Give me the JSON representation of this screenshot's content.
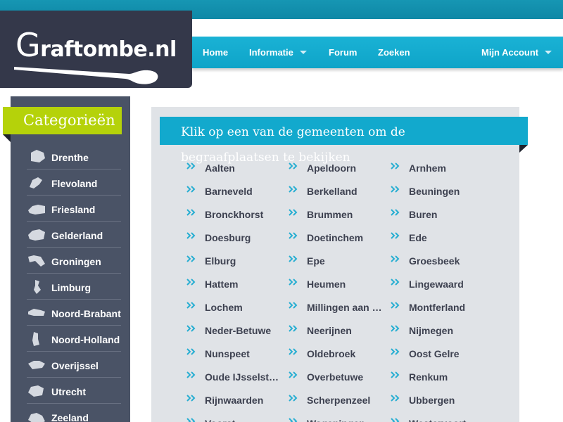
{
  "site": {
    "logo_text": "raftombe.nl",
    "logo_initial": "G"
  },
  "nav": {
    "items": [
      {
        "label": "Home"
      },
      {
        "label": "Informatie"
      },
      {
        "label": "Forum"
      },
      {
        "label": "Zoeken"
      },
      {
        "label": "Mijn Account"
      }
    ]
  },
  "sidebar": {
    "title": "Categorieën",
    "items": [
      {
        "label": "Drenthe"
      },
      {
        "label": "Flevoland"
      },
      {
        "label": "Friesland"
      },
      {
        "label": "Gelderland"
      },
      {
        "label": "Groningen"
      },
      {
        "label": "Limburg"
      },
      {
        "label": "Noord-Brabant"
      },
      {
        "label": "Noord-Holland"
      },
      {
        "label": "Overijssel"
      },
      {
        "label": "Utrecht"
      },
      {
        "label": "Zeeland"
      }
    ]
  },
  "main": {
    "heading": "Klik op een van de gemeenten om de begraafplaatsen te bekijken",
    "columns": [
      [
        "Aalten",
        "Barneveld",
        "Bronckhorst",
        "Doesburg",
        "Elburg",
        "Hattem",
        "Lochem",
        "Neder-Betuwe",
        "Nunspeet",
        "Oude IJsselstreek",
        "Rijnwaarden",
        "Voorst"
      ],
      [
        "Apeldoorn",
        "Berkelland",
        "Brummen",
        "Doetinchem",
        "Epe",
        "Heumen",
        "Millingen aan de Rijn",
        "Neerijnen",
        "Oldebroek",
        "Overbetuwe",
        "Scherpenzeel",
        "Wageningen"
      ],
      [
        "Arnhem",
        "Beuningen",
        "Buren",
        "Ede",
        "Groesbeek",
        "Lingewaard",
        "Montferland",
        "Nijmegen",
        "Oost Gelre",
        "Renkum",
        "Ubbergen",
        "Westervoort"
      ]
    ]
  },
  "colors": {
    "accent": "#12a9cd",
    "category_green": "#b5d20a",
    "sidebar_bg": "#4a5366",
    "logo_bg": "#34384a",
    "panel_bg": "#e0e3e7"
  }
}
